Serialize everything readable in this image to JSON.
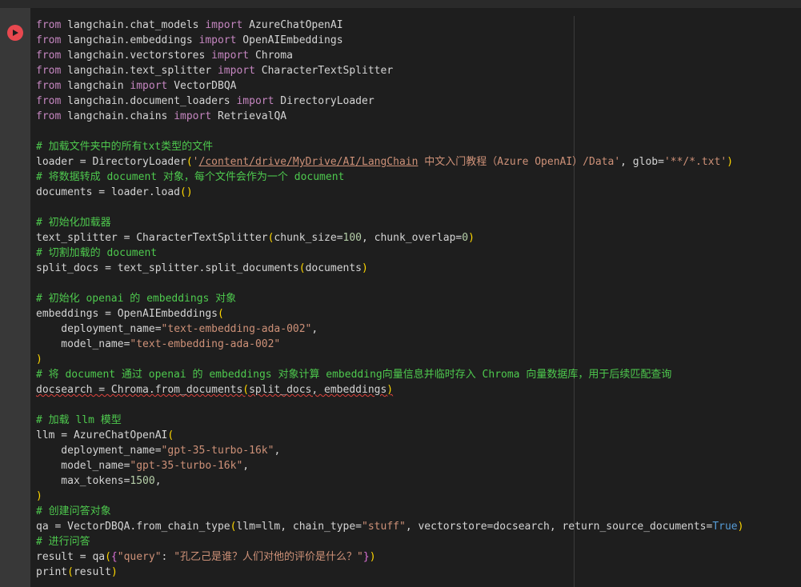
{
  "cell": {
    "run_icon": "play-icon",
    "lines": [
      [
        {
          "t": "from",
          "c": "kw"
        },
        {
          "t": " langchain.chat_models ",
          "c": "pl"
        },
        {
          "t": "import",
          "c": "kw"
        },
        {
          "t": " AzureChatOpenAI",
          "c": "pl"
        }
      ],
      [
        {
          "t": "from",
          "c": "kw"
        },
        {
          "t": " langchain.embeddings ",
          "c": "pl"
        },
        {
          "t": "import",
          "c": "kw"
        },
        {
          "t": " OpenAIEmbeddings",
          "c": "pl"
        }
      ],
      [
        {
          "t": "from",
          "c": "kw"
        },
        {
          "t": " langchain.vectorstores ",
          "c": "pl"
        },
        {
          "t": "import",
          "c": "kw"
        },
        {
          "t": " Chroma",
          "c": "pl"
        }
      ],
      [
        {
          "t": "from",
          "c": "kw"
        },
        {
          "t": " langchain.text_splitter ",
          "c": "pl"
        },
        {
          "t": "import",
          "c": "kw"
        },
        {
          "t": " CharacterTextSplitter",
          "c": "pl"
        }
      ],
      [
        {
          "t": "from",
          "c": "kw"
        },
        {
          "t": " langchain ",
          "c": "pl"
        },
        {
          "t": "import",
          "c": "kw"
        },
        {
          "t": " VectorDBQA",
          "c": "pl"
        }
      ],
      [
        {
          "t": "from",
          "c": "kw"
        },
        {
          "t": " langchain.document_loaders ",
          "c": "pl"
        },
        {
          "t": "import",
          "c": "kw"
        },
        {
          "t": " DirectoryLoader",
          "c": "pl"
        }
      ],
      [
        {
          "t": "from",
          "c": "kw"
        },
        {
          "t": " langchain.chains ",
          "c": "pl"
        },
        {
          "t": "import",
          "c": "kw"
        },
        {
          "t": " RetrievalQA",
          "c": "pl"
        }
      ],
      [],
      [
        {
          "t": "# 加载文件夹中的所有txt类型的文件",
          "c": "cmt"
        }
      ],
      [
        {
          "t": "loader = DirectoryLoader",
          "c": "pl"
        },
        {
          "t": "(",
          "c": "p1"
        },
        {
          "t": "'",
          "c": "str"
        },
        {
          "t": "/content/drive/MyDrive/AI/LangChain",
          "c": "str link"
        },
        {
          "t": " 中文入门教程（Azure OpenAI）/Data'",
          "c": "str"
        },
        {
          "t": ", glob=",
          "c": "pl"
        },
        {
          "t": "'**/*.txt'",
          "c": "str"
        },
        {
          "t": ")",
          "c": "p1"
        }
      ],
      [
        {
          "t": "# 将数据转成 document 对象，每个文件会作为一个 document",
          "c": "cmt"
        }
      ],
      [
        {
          "t": "documents = loader.load",
          "c": "pl"
        },
        {
          "t": "()",
          "c": "p1"
        }
      ],
      [],
      [
        {
          "t": "# 初始化加载器",
          "c": "cmt"
        }
      ],
      [
        {
          "t": "text_splitter = CharacterTextSplitter",
          "c": "pl"
        },
        {
          "t": "(",
          "c": "p1"
        },
        {
          "t": "chunk_size=",
          "c": "pl"
        },
        {
          "t": "100",
          "c": "num"
        },
        {
          "t": ", chunk_overlap=",
          "c": "pl"
        },
        {
          "t": "0",
          "c": "num"
        },
        {
          "t": ")",
          "c": "p1"
        }
      ],
      [
        {
          "t": "# 切割加载的 document",
          "c": "cmt"
        }
      ],
      [
        {
          "t": "split_docs = text_splitter.split_documents",
          "c": "pl"
        },
        {
          "t": "(",
          "c": "p1"
        },
        {
          "t": "documents",
          "c": "pl"
        },
        {
          "t": ")",
          "c": "p1"
        }
      ],
      [],
      [
        {
          "t": "# 初始化 openai 的 embeddings 对象",
          "c": "cmt"
        }
      ],
      [
        {
          "t": "embeddings = OpenAIEmbeddings",
          "c": "pl"
        },
        {
          "t": "(",
          "c": "p1"
        }
      ],
      [
        {
          "t": "    deployment_name=",
          "c": "pl"
        },
        {
          "t": "\"text-embedding-ada-002\"",
          "c": "str"
        },
        {
          "t": ",",
          "c": "pl"
        }
      ],
      [
        {
          "t": "    model_name=",
          "c": "pl"
        },
        {
          "t": "\"text-embedding-ada-002\"",
          "c": "str"
        }
      ],
      [
        {
          "t": ")",
          "c": "p1"
        }
      ],
      [
        {
          "t": "# 将 document 通过 openai 的 embeddings 对象计算 embedding向量信息并临时存入 Chroma 向量数据库，用于后续匹配查询",
          "c": "cmt"
        }
      ],
      [
        {
          "t": "docsearch = Chroma.from_documents",
          "c": "pl squiggle"
        },
        {
          "t": "(",
          "c": "p1 squiggle"
        },
        {
          "t": "split_docs, embeddings",
          "c": "pl squiggle"
        },
        {
          "t": ")",
          "c": "p1 squiggle"
        }
      ],
      [],
      [
        {
          "t": "# 加载 llm 模型",
          "c": "cmt"
        }
      ],
      [
        {
          "t": "llm = AzureChatOpenAI",
          "c": "pl"
        },
        {
          "t": "(",
          "c": "p1"
        }
      ],
      [
        {
          "t": "    deployment_name=",
          "c": "pl"
        },
        {
          "t": "\"gpt-35-turbo-16k\"",
          "c": "str"
        },
        {
          "t": ",",
          "c": "pl"
        }
      ],
      [
        {
          "t": "    model_name=",
          "c": "pl"
        },
        {
          "t": "\"gpt-35-turbo-16k\"",
          "c": "str"
        },
        {
          "t": ",",
          "c": "pl"
        }
      ],
      [
        {
          "t": "    max_tokens=",
          "c": "pl"
        },
        {
          "t": "1500",
          "c": "num"
        },
        {
          "t": ",",
          "c": "pl"
        }
      ],
      [
        {
          "t": ")",
          "c": "p1"
        }
      ],
      [
        {
          "t": "# 创建问答对象",
          "c": "cmt"
        }
      ],
      [
        {
          "t": "qa = VectorDBQA.from_chain_type",
          "c": "pl"
        },
        {
          "t": "(",
          "c": "p1"
        },
        {
          "t": "llm=llm, chain_type=",
          "c": "pl"
        },
        {
          "t": "\"stuff\"",
          "c": "str"
        },
        {
          "t": ", vectorstore=docsearch, return_source_documents=",
          "c": "pl"
        },
        {
          "t": "True",
          "c": "bool"
        },
        {
          "t": ")",
          "c": "p1"
        }
      ],
      [
        {
          "t": "# 进行问答",
          "c": "cmt"
        }
      ],
      [
        {
          "t": "result = qa",
          "c": "pl"
        },
        {
          "t": "(",
          "c": "p1"
        },
        {
          "t": "{",
          "c": "p2"
        },
        {
          "t": "\"query\"",
          "c": "str"
        },
        {
          "t": ": ",
          "c": "pl"
        },
        {
          "t": "\"孔乙己是谁？人们对他的评价是什么？\"",
          "c": "str"
        },
        {
          "t": "}",
          "c": "p2"
        },
        {
          "t": ")",
          "c": "p1"
        }
      ],
      [
        {
          "t": "print",
          "c": "pl"
        },
        {
          "t": "(",
          "c": "p1"
        },
        {
          "t": "result",
          "c": "pl"
        },
        {
          "t": ")",
          "c": "p1"
        }
      ]
    ]
  }
}
